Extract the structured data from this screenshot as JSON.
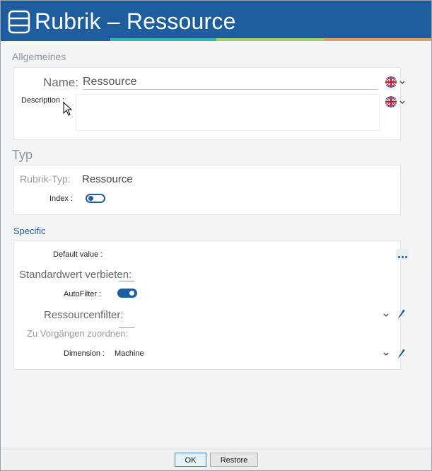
{
  "window": {
    "title": "Rubrik – Ressource",
    "accent_colors": [
      "#1f5e9e",
      "#2fb8a4",
      "#a6cf5d",
      "#e1a15a"
    ],
    "title_bg": "#1f5e9e"
  },
  "general": {
    "section_title": "Allgemeines",
    "name_label": "Name:",
    "name_value": "Ressource",
    "description_label": "Description :",
    "description_value": "",
    "language_icon": "uk-flag-icon"
  },
  "type": {
    "section_title": "Typ",
    "rubric_type_label": "Rubrik-Typ:",
    "rubric_type_value": "Ressource",
    "index_label": "Index :",
    "index_on": false
  },
  "specific": {
    "section_title": "Specific",
    "default_value_label": "Default value :",
    "forbid_default_label": "Standardwert verbieten:",
    "autofilter_label": "AutoFilter :",
    "autofilter_on": true,
    "resource_filter_label": "Ressourcenfilter:",
    "assign_label": "Zu Vorgängen zuordnen:",
    "dimension_label": "Dimension :",
    "dimension_value": "Machine"
  },
  "footer": {
    "ok_label": "OK",
    "restore_label": "Restore"
  }
}
